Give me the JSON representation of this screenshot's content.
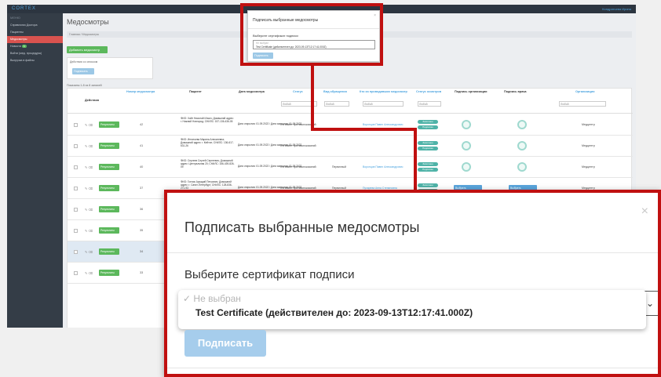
{
  "app": {
    "brand": "CORTEX",
    "sidebar": {
      "section": "МЕНЮ",
      "items": [
        {
          "label": "Справочник Доктора"
        },
        {
          "label": "Пациенты"
        },
        {
          "label": "Медосмотры"
        },
        {
          "label": "Новости",
          "badge": "1"
        },
        {
          "label": "Войти (мед. процедуры)"
        },
        {
          "label": "Выгрузка в файлы"
        }
      ]
    },
    "page_title": "Медосмотры",
    "breadcrumb": "Главная / Медосмотры",
    "add_button": "Добавить медосмотр",
    "actions_label": "Действия со списком",
    "actions_go": "Подписать",
    "shown_label": "Показаны 1-8 из 8 записей",
    "columns": [
      "Действия",
      "Номер медосмотра",
      "Пациент",
      "Дата медосмотра",
      "Статус",
      "Вид обращения",
      "Кто из проводивших медосмотр",
      "Статус осмотров",
      "Подпись организации",
      "Подпись врача",
      "Организация"
    ],
    "filter_default": "Любой",
    "rows": [
      {
        "button": "Результаты",
        "number": "42",
        "patient": "ФИО: Хайт Николай Ильич; Домашний адрес: г. Нижний Новгород; СНИЛС: 157-136-436-05",
        "dates": "Дата открытия: 01.09.2022 / Дата закрытия: 01.09.2022",
        "status": "Не имеет противопоказаний",
        "type": "",
        "who": "Воронцов Павел Александрович",
        "org": "Медцентр"
      },
      {
        "button": "Результаты",
        "number": "41",
        "patient": "ФИО: Игнатьева Марина Алексеевна; Домашний адрес: г. Кейтон; СНИЛС: 136-617-631-26",
        "dates": "Дата открытия: 01.09.2022 / Дата закрытия: 01.09.2022",
        "status": "Не имеет противопоказаний",
        "type": "",
        "who": "",
        "org": "Медцентр"
      },
      {
        "button": "Результаты",
        "number": "40",
        "patient": "ФИО: Сергеев Сергей Сергеевич; Домашний адрес: Центральная 20; СНИЛС: 156-439-826-09",
        "dates": "Дата открытия: 01.09.2022 / Дата закрытия: 01.09.2022",
        "status": "Не имеет противопоказаний",
        "type": "Первичный",
        "who": "Воронцов Павел Александрович",
        "org": "Медцентр"
      },
      {
        "button": "Результаты",
        "number": "37",
        "patient": "ФИО: Гончик Аркадий Петрович; Домашний адрес: г. Санкт-Петербург; СНИЛС: 128-836-271-93",
        "dates": "Дата открытия: 01.09.2022 / Дата закрытия: 01.09.2022",
        "status": "Не имеет противопоказаний",
        "type": "Первичный",
        "who": "Пухарева Анна Степановна",
        "sign_org": "Выбрать",
        "sign_doc": "Выбрать",
        "org": "Медцентр"
      },
      {
        "button": "Результаты",
        "number": "36",
        "patient": "ФИО: Гончик Аркадий Петрович; Домашний адрес: г. Санкт-Петербург; СНИЛС: 128-836-271-93",
        "dates": "Дата открытия: 01.09.2022 / Дата закрытия: 01.09.2022",
        "status": "Не имеет противопоказаний",
        "type": "Первичный",
        "who": "Воронцов Павел Александрович",
        "nsign_org": "Для медосмотра не сформирован файл",
        "nsign_doc": "Для медосмотра не сформирован файл",
        "org": "Медцентр"
      },
      {
        "button": "Результаты",
        "number": "35",
        "patient": "ФИО:",
        "dates": "",
        "status": "",
        "type": "",
        "who": "",
        "org": ""
      },
      {
        "button": "Результаты",
        "number": "34",
        "patient": "ФИО:",
        "dates": "",
        "status": "",
        "type": "",
        "who": "",
        "org": ""
      },
      {
        "button": "Результаты",
        "number": "33",
        "patient": "ФИО:",
        "dates": "",
        "status": "",
        "type": "",
        "who": "",
        "org": ""
      }
    ],
    "status_chip_1": "Заполнен",
    "status_chip_2": "Подписан",
    "user": "Кондратьева Ирина"
  },
  "modal": {
    "title": "Подписать выбранные медосмотры",
    "close": "×",
    "label": "Выберите сертификат подписи",
    "placeholder": "Не выбран",
    "option": "Test Certificate (действителен до: 2023-09-13T12:17:41.000Z)",
    "button": "Подписать",
    "checkmark": "✓",
    "caret": "⌄"
  }
}
